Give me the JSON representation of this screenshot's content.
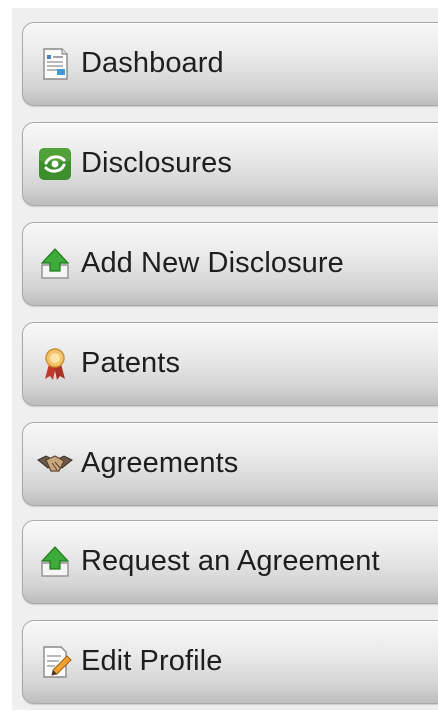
{
  "menu": {
    "items": [
      {
        "label": "Dashboard",
        "icon": "dashboard-document-icon"
      },
      {
        "label": "Disclosures",
        "icon": "disclosures-green-icon"
      },
      {
        "label": "Add New Disclosure",
        "icon": "upload-arrow-icon"
      },
      {
        "label": "Patents",
        "icon": "award-ribbon-icon"
      },
      {
        "label": "Agreements",
        "icon": "handshake-icon"
      },
      {
        "label": "Request an Agreement",
        "icon": "upload-arrow-icon"
      },
      {
        "label": "Edit Profile",
        "icon": "edit-document-icon"
      }
    ]
  },
  "colors": {
    "panel_bg": "#efefef",
    "item_border": "#a9a9a9",
    "text": "#1e1e1e",
    "green_icon": "#3d8f2e",
    "award_red": "#c0392b"
  }
}
